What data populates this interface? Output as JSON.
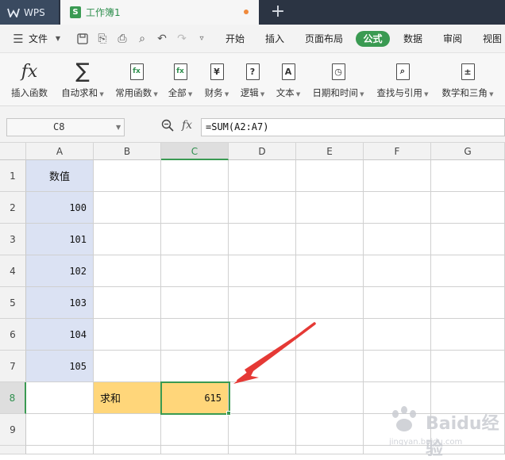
{
  "titlebar": {
    "app_tab": "WPS",
    "doc_tab": "工作簿1",
    "doc_icon": "S",
    "new_tab_icon": "plus-icon"
  },
  "menubar": {
    "file": "文件",
    "tabs": [
      "开始",
      "插入",
      "页面布局",
      "公式",
      "数据",
      "审阅",
      "视图"
    ],
    "active_tab": "公式"
  },
  "ribbon": {
    "buttons": [
      {
        "label": "插入函数",
        "icon": "fx-icon",
        "glyph": "ƒx"
      },
      {
        "label": "自动求和",
        "icon": "sigma-icon",
        "glyph": "∑"
      },
      {
        "label": "常用函数",
        "icon": "star-function-icon",
        "glyph": "fx"
      },
      {
        "label": "全部",
        "icon": "function-icon",
        "glyph": "fx"
      },
      {
        "label": "财务",
        "icon": "yen-icon",
        "glyph": "¥"
      },
      {
        "label": "逻辑",
        "icon": "question-icon",
        "glyph": "?"
      },
      {
        "label": "文本",
        "icon": "text-a-icon",
        "glyph": "A"
      },
      {
        "label": "日期和时间",
        "icon": "clock-icon",
        "glyph": "◷"
      },
      {
        "label": "查找与引用",
        "icon": "magnifier-icon",
        "glyph": "⌕"
      },
      {
        "label": "数学和三角",
        "icon": "plus-minus-icon",
        "glyph": "±"
      }
    ]
  },
  "formula_bar": {
    "name_box": "C8",
    "fx": "fx",
    "formula": "=SUM(A2:A7)"
  },
  "sheet": {
    "columns": [
      "A",
      "B",
      "C",
      "D",
      "E",
      "F",
      "G"
    ],
    "rows": [
      "1",
      "2",
      "3",
      "4",
      "5",
      "6",
      "7",
      "8",
      "9"
    ],
    "active_col": "C",
    "active_row": "8",
    "cells": {
      "A1": "数值",
      "A2": "100",
      "A3": "101",
      "A4": "102",
      "A5": "103",
      "A6": "104",
      "A7": "105",
      "B8": "求和",
      "C8": "615"
    },
    "highlight_blue": "#dbe2f3",
    "highlight_yellow": "#ffd67a",
    "accent": "#3a9a52",
    "arrow_color": "#e53935"
  },
  "watermark": {
    "brand": "Baidu经验",
    "url": "jingyan.baidu.com"
  }
}
